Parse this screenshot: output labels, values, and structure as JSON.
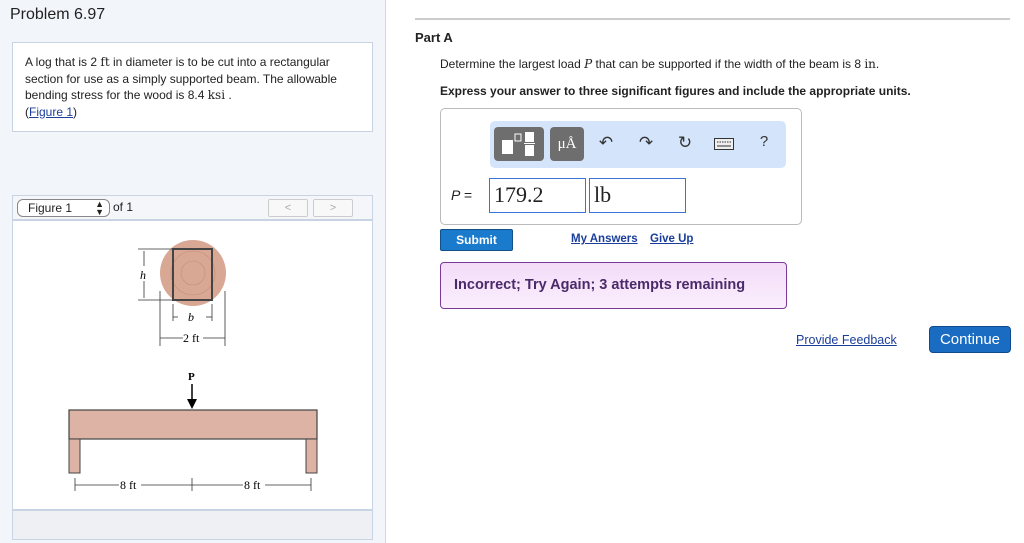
{
  "problem": {
    "title": "Problem 6.97",
    "text_1": "A log that is 2 ",
    "unit_ft": "ft",
    "text_2": " in diameter is to be cut into a rectangular section for use as a simply supported beam. The allowable bending stress for the wood is 8.4 ",
    "unit_ksi": "ksi",
    "text_3": " .",
    "figure_link": "Figure 1"
  },
  "figure": {
    "select": "Figure 1",
    "of": "of 1",
    "prev": "<",
    "next": ">",
    "labels": {
      "h": "h",
      "b": "b",
      "diameter": "2 ft",
      "load": "P",
      "span_left": "8 ft",
      "span_right": "8 ft"
    }
  },
  "part": {
    "title": "Part A",
    "question_1": "Determine the largest load ",
    "question_var": "P",
    "question_2": " that can be supported if the width of the beam is 8 ",
    "question_unit": "in",
    "question_3": ".",
    "instruction": "Express your answer to three significant figures and include the appropriate units."
  },
  "answer": {
    "label": "P =",
    "value": "179.2",
    "unit": "lb",
    "units_button": "μÅ",
    "help": "?"
  },
  "actions": {
    "submit": "Submit",
    "my_answers": "My Answers",
    "give_up": "Give Up"
  },
  "feedback": "Incorrect; Try Again; 3 attempts remaining",
  "footer": {
    "provide_feedback": "Provide Feedback",
    "continue": "Continue"
  },
  "colors": {
    "accent": "#1a7acc",
    "feedback_bg": "#f3dcf8",
    "toolbar_bg": "#d4e5fb"
  }
}
